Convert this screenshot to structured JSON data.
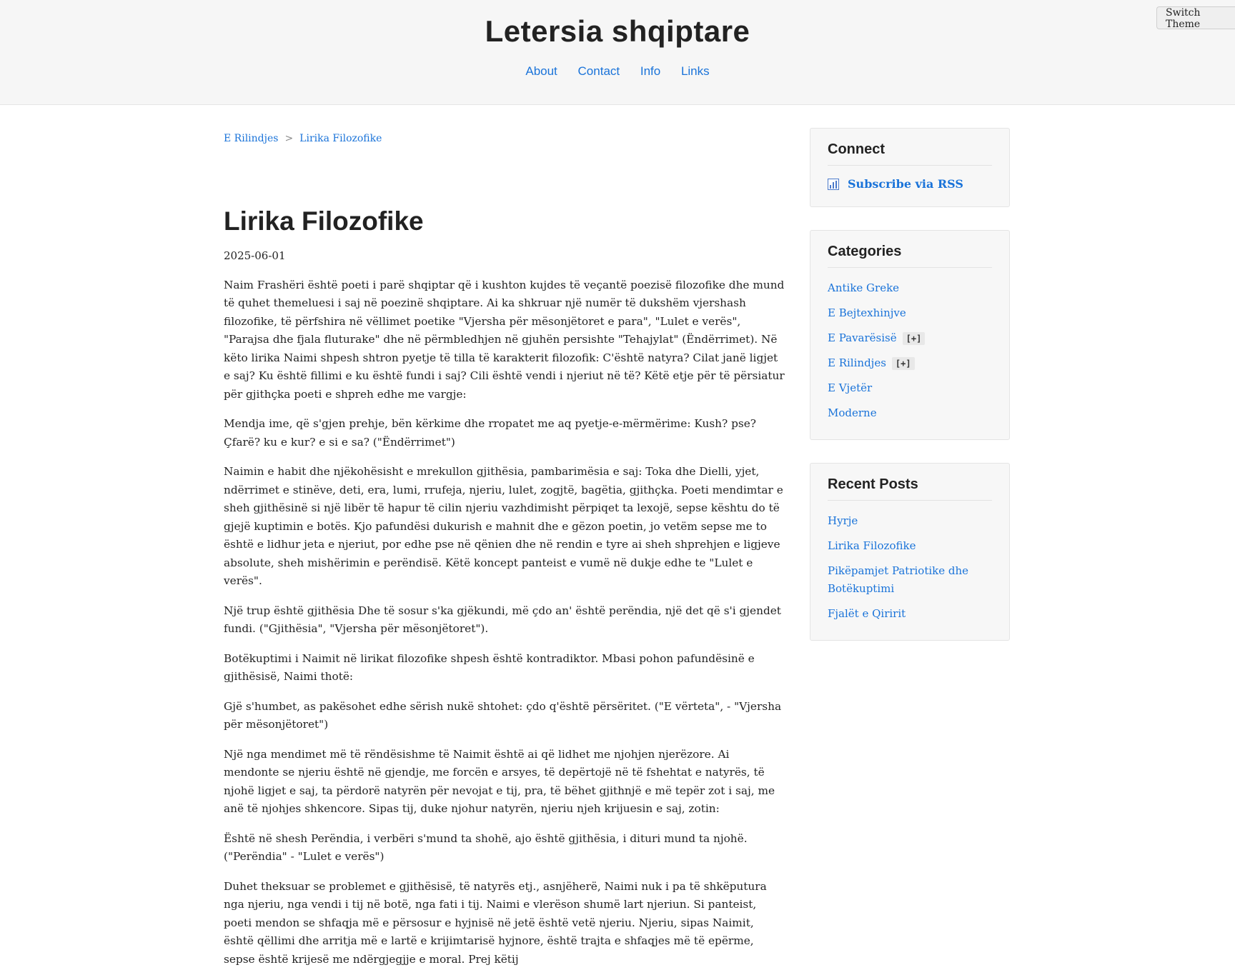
{
  "header": {
    "site_title": "Letersia shqiptare",
    "nav": [
      "About",
      "Contact",
      "Info",
      "Links"
    ],
    "switch_theme": "Switch Theme"
  },
  "breadcrumb": {
    "items": [
      "E Rilindjes",
      "Lirika Filozofike"
    ],
    "separator": ">"
  },
  "post": {
    "title": "Lirika Filozofike",
    "date": "2025-06-01",
    "paragraphs": [
      "Naim Frashëri është poeti i parë shqiptar që i kushton kujdes të veçantë poezisë filozofike dhe mund të quhet themeluesi i saj në poezinë shqiptare. Ai ka shkruar një numër të dukshëm vjershash filozofike, të përfshira në vëllimet poetike \"Vjersha për mësonjëtoret e para\", \"Lulet e verës\", \"Parajsa dhe fjala fluturake\" dhe në përmbledhjen në gjuhën persishte \"Tehajylat\" (Ëndërrimet). Në këto lirika Naimi shpesh shtron pyetje të tilla të karakterit filozofik: C'është natyra? Cilat janë ligjet e saj? Ku është fillimi e ku është fundi i saj? Cili është vendi i njeriut në të? Këtë etje për të përsiatur për gjithçka poeti e shpreh edhe me vargje:",
      "Mendja ime, që s'gjen prehje, bën kërkime dhe rropatet me aq pyetje-e-mërmërime: Kush? pse? Çfarë? ku e kur? e si e sa? (\"Ëndërrimet\")",
      "Naimin e habit dhe njëkohësisht e mrekullon gjithësia, pambarimësia e saj: Toka dhe Dielli, yjet, ndërrimet e stinëve, deti, era, lumi, rrufeja, njeriu, lulet, zogjtë, bagëtia, gjithçka. Poeti mendimtar e sheh gjithësinë si një libër të hapur të cilin njeriu vazhdimisht përpiqet ta lexojë, sepse kështu do të gjejë kuptimin e botës. Kjo pafundësi dukurish e mahnit dhe e gëzon poetin, jo vetëm sepse me to është e lidhur jeta e njeriut, por edhe pse në qënien dhe në rendin e tyre ai sheh shprehjen e ligjeve absolute, sheh mishërimin e perëndisë. Këtë koncept panteist e vumë në dukje edhe te \"Lulet e verës\".",
      "Një trup është gjithësia Dhe të sosur s'ka gjëkundi, më çdo an' është perëndia, një det që s'i gjendet fundi. (\"Gjithësia\", \"Vjersha për mësonjëtoret\").",
      "Botëkuptimi i Naimit në lirikat filozofike shpesh është kontradiktor. Mbasi pohon pafundësinë e gjithësisë, Naimi thotë:",
      "Gjë s'humbet, as pakësohet edhe sërish nukë shtohet: çdo q'është përsëritet. (\"E vërteta\", - \"Vjersha për mësonjëtoret\")",
      "Një nga mendimet më të rëndësishme të Naimit është ai që lidhet me njohjen njerëzore. Ai mendonte se njeriu është në gjendje, me forcën e arsyes, të depërtojë në të fshehtat e natyrës, të njohë ligjet e saj, ta përdorë natyrën për nevojat e tij, pra, të bëhet gjithnjë e më tepër zot i saj, me anë të njohjes shkencore. Sipas tij, duke njohur natyrën, njeriu njeh krijuesin e saj, zotin:",
      "Është në shesh Perëndia, i verbëri s'mund ta shohë, ajo është gjithësia, i dituri mund ta njohë. (\"Perëndia\" - \"Lulet e verës\")",
      "Duhet theksuar se problemet e gjithësisë, të natyrës etj., asnjëherë, Naimi nuk i pa të shkëputura nga njeriu, nga vendi i tij në botë, nga fati i tij. Naimi e vlerëson shumë lart njeriun. Si panteist, poeti mendon se shfaqja më e përsosur e hyjnisë në jetë është vetë njeriu. Njeriu, sipas Naimit, është qëllimi dhe arritja më e lartë e krijimtarisë hyjnore, është trajta e shfaqjes më të epërme, sepse është krijesë me ndërgjegjje e moral. Prej këtij"
    ]
  },
  "sidebar": {
    "connect": {
      "title": "Connect",
      "rss_label": "Subscribe via RSS",
      "rss_icon": "rss-icon"
    },
    "categories": {
      "title": "Categories",
      "items": [
        "Antike Greke",
        "E Bejtexhinjve",
        "E Pavarësisë",
        "E Rilindjes",
        "E Vjetër",
        "Moderne"
      ],
      "expand_label": "[+]"
    },
    "recent_posts": {
      "title": "Recent Posts",
      "items": [
        "Hyrje",
        "Lirika Filozofike",
        "Pikëpamjet Patriotike dhe Botëkuptimi",
        "Fjalët e Qiririt"
      ]
    }
  },
  "colors": {
    "link": "#1a73d9",
    "header_bg": "#f6f6f6",
    "widget_bg": "#f7f7f7"
  }
}
